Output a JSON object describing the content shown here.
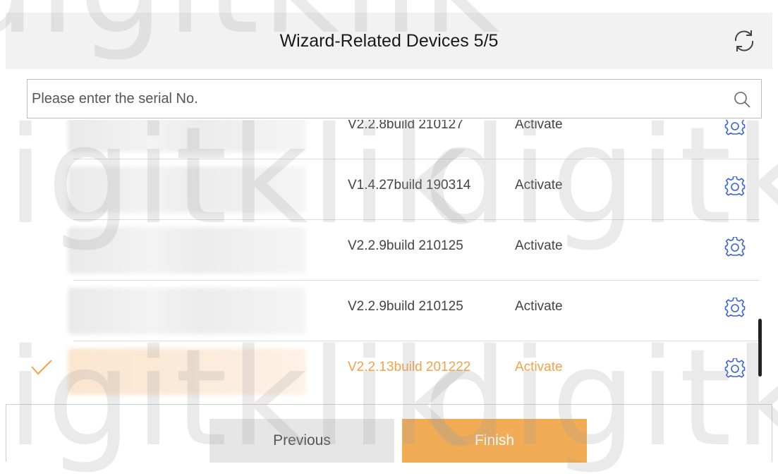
{
  "header": {
    "title": "Wizard-Related Devices 5/5"
  },
  "search": {
    "placeholder": "Please enter the serial No."
  },
  "devices": [
    {
      "version": "V2.2.8build 210127",
      "status": "Activate",
      "selected": false
    },
    {
      "version": "V1.4.27build 190314",
      "status": "Activate",
      "selected": false
    },
    {
      "version": "V2.2.9build 210125",
      "status": "Activate",
      "selected": false
    },
    {
      "version": "V2.2.9build 210125",
      "status": "Activate",
      "selected": false
    },
    {
      "version": "V2.2.13build 201222",
      "status": "Activate",
      "selected": true
    }
  ],
  "footer": {
    "previous_label": "Previous",
    "finish_label": "Finish"
  },
  "watermark": {
    "text": "digitklik"
  },
  "colors": {
    "accent": "#f1ac55",
    "selected_text": "#f0a44a",
    "icon_blue": "#3b62d9"
  }
}
